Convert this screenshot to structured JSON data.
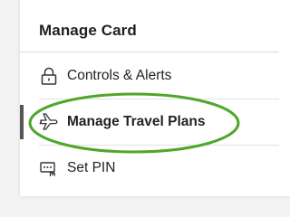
{
  "card": {
    "title": "Manage Card"
  },
  "menu": {
    "items": [
      {
        "label": "Controls & Alerts",
        "icon": "lock-icon"
      },
      {
        "label": "Manage Travel Plans",
        "icon": "airplane-icon",
        "active": true
      },
      {
        "label": "Set PIN",
        "icon": "pin-keypad-icon"
      }
    ]
  },
  "colors": {
    "highlight": "#4fa62a",
    "active_bar": "#555555",
    "text": "#222222"
  }
}
